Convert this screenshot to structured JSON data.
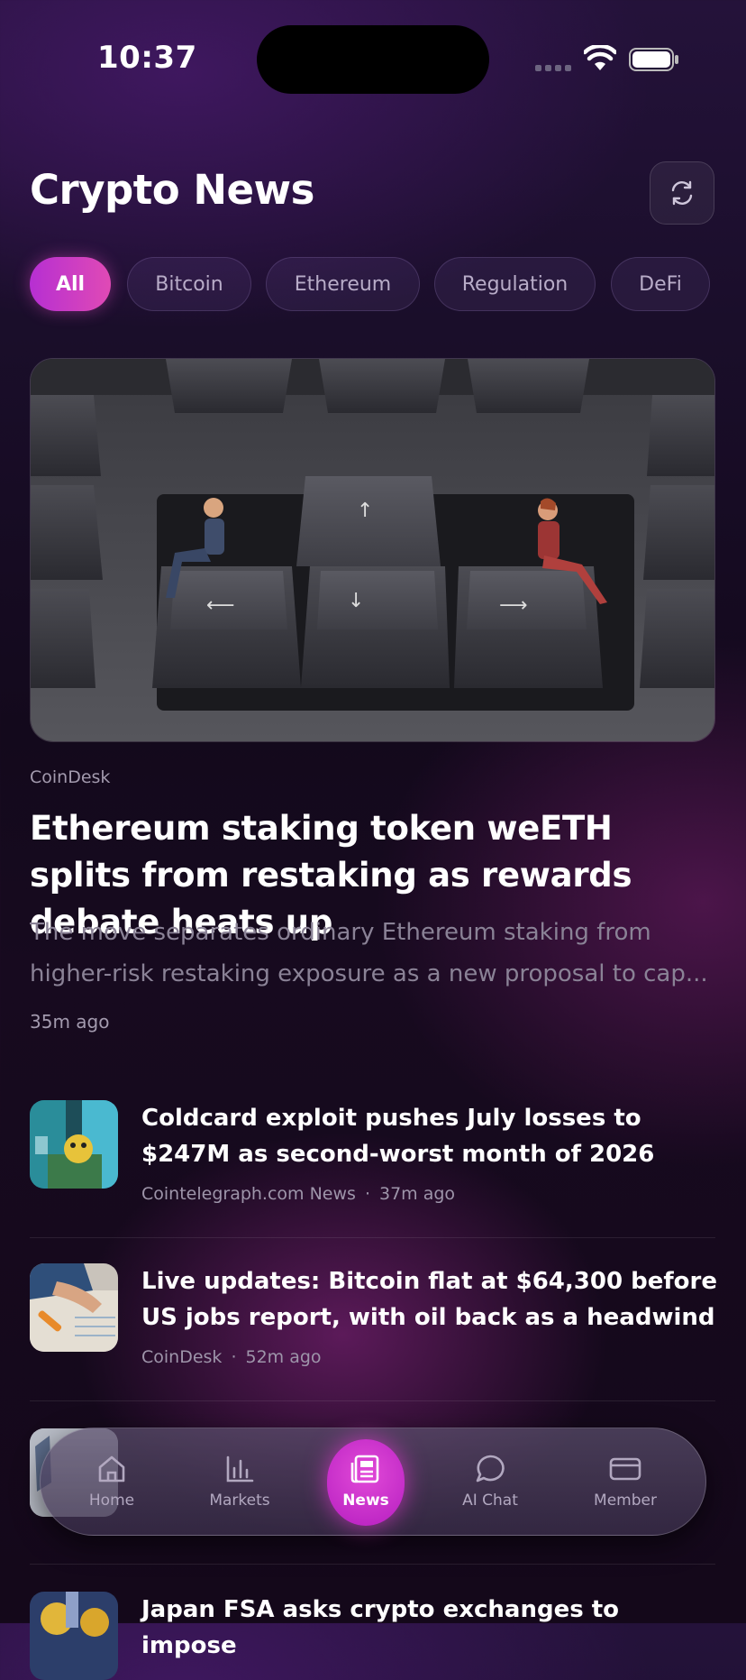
{
  "status": {
    "time": "10:37"
  },
  "header": {
    "title": "Crypto News"
  },
  "filters": [
    "All",
    "Bitcoin",
    "Ethereum",
    "Regulation",
    "DeFi"
  ],
  "featured": {
    "source": "CoinDesk",
    "title": "Ethereum staking token weETH splits from restaking as rewards debate heats up",
    "description": "The move separates ordinary Ethereum staking from higher-risk restaking exposure as a new proposal to cap...",
    "time": "35m ago"
  },
  "articles": [
    {
      "title": "Coldcard exploit pushes July losses to $247M as second-worst month of 2026",
      "source": "Cointelegraph.com News",
      "time": "37m ago"
    },
    {
      "title": "Live updates: Bitcoin flat at $64,300 before US jobs report, with oil back as a headwind",
      "source": "CoinDesk",
      "time": "52m ago"
    },
    {
      "title": "Japan FSA asks crypto exchanges to impose"
    }
  ],
  "nav": [
    {
      "label": "Home",
      "icon": "home-icon"
    },
    {
      "label": "Markets",
      "icon": "bar-chart-icon"
    },
    {
      "label": "News",
      "icon": "newspaper-icon"
    },
    {
      "label": "AI Chat",
      "icon": "chat-bubble-icon"
    },
    {
      "label": "Member",
      "icon": "card-icon"
    }
  ],
  "colors": {
    "accent": "#c533d0",
    "background": "#160a20"
  }
}
